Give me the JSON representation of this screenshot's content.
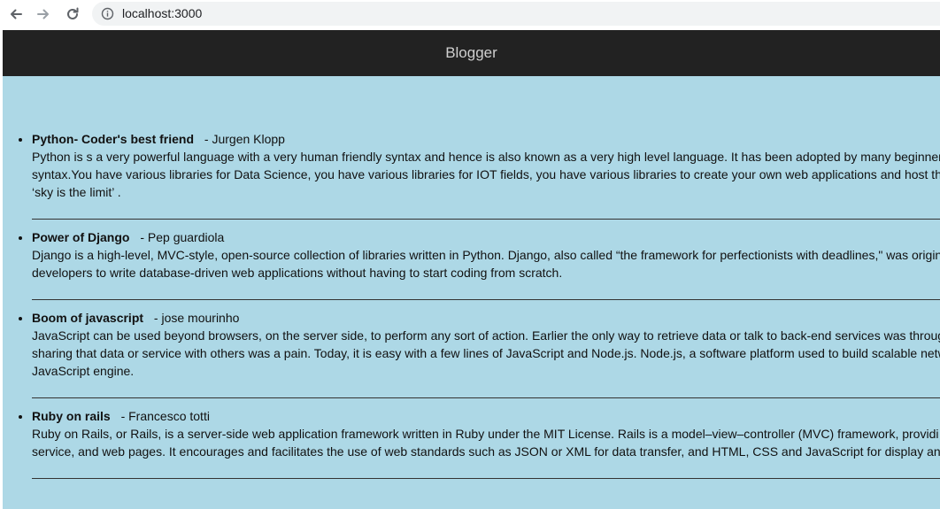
{
  "browser": {
    "url": "localhost:3000",
    "icons": [
      "back-arrow-icon",
      "forward-arrow-icon",
      "reload-icon",
      "info-icon"
    ]
  },
  "header": {
    "title": "Blogger"
  },
  "posts": [
    {
      "title": "Python- Coder's best friend",
      "author": "- Jurgen Klopp",
      "lines": [
        "Python is s a very powerful language with a very human friendly syntax and hence is also known as a very high level language. It has been adopted by many beginner",
        "syntax.You have various libraries for Data Science, you have various libraries for IOT fields, you have various libraries to create your own web applications and host th",
        "‘sky is the limit’ ."
      ]
    },
    {
      "title": "Power of Django",
      "author": "- Pep guardiola",
      "lines": [
        "Django is a high-level, MVC-style, open-source collection of libraries written in Python. Django, also called “the framework for perfectionists with deadlines,\" was origin",
        "developers to write database-driven web applications without having to start coding from scratch."
      ]
    },
    {
      "title": "Boom of javascript",
      "author": "- jose mourinho",
      "lines": [
        "JavaScript can be used beyond browsers, on the server side, to perform any sort of action. Earlier the only way to retrieve data or talk to back-end services was throug",
        "sharing that data or service with others was a pain. Today, it is easy with a few lines of JavaScript and Node.js. Node.js, a software platform used to build scalable netw",
        "JavaScript engine."
      ]
    },
    {
      "title": "Ruby on rails",
      "author": "- Francesco totti",
      "lines": [
        "Ruby on Rails, or Rails, is a server-side web application framework written in Ruby under the MIT License. Rails is a model–view–controller (MVC) framework, providi",
        "service, and web pages. It encourages and facilitates the use of web standards such as JSON or XML for data transfer, and HTML, CSS and JavaScript for display an"
      ]
    }
  ]
}
